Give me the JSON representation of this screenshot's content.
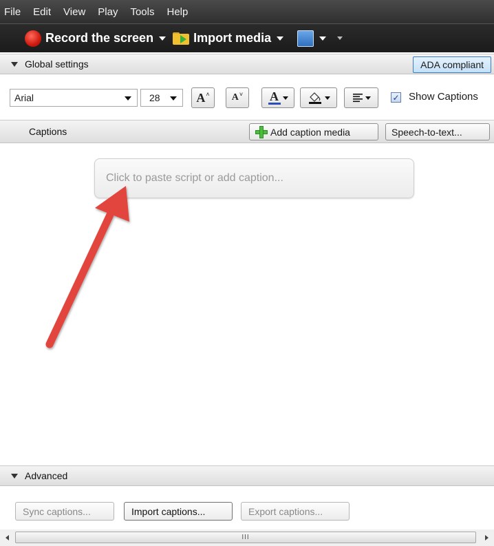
{
  "menu": [
    "File",
    "Edit",
    "View",
    "Play",
    "Tools",
    "Help"
  ],
  "toolbar": {
    "record_label": "Record the screen",
    "import_label": "Import media"
  },
  "global_settings": {
    "title": "Global settings",
    "ada_label": "ADA compliant"
  },
  "settings": {
    "font": "Arial",
    "size": "28",
    "increase_label": "A",
    "decrease_label": "A",
    "font_color_label": "A",
    "show_captions_label": "Show Captions",
    "show_captions_checked": true
  },
  "captions": {
    "title": "Captions",
    "add_media_label": "Add caption media",
    "speech_label": "Speech-to-text...",
    "placeholder": "Click to paste script or add caption..."
  },
  "advanced": {
    "title": "Advanced",
    "sync_label": "Sync captions...",
    "import_label": "Import captions...",
    "export_label": "Export captions..."
  },
  "scrollbar": {
    "grip": "III"
  },
  "colors": {
    "annotation_arrow": "#e2453d",
    "ada_accent": "#3b7cc4",
    "record": "#d01a10",
    "add_plus": "#4bbf3d"
  }
}
